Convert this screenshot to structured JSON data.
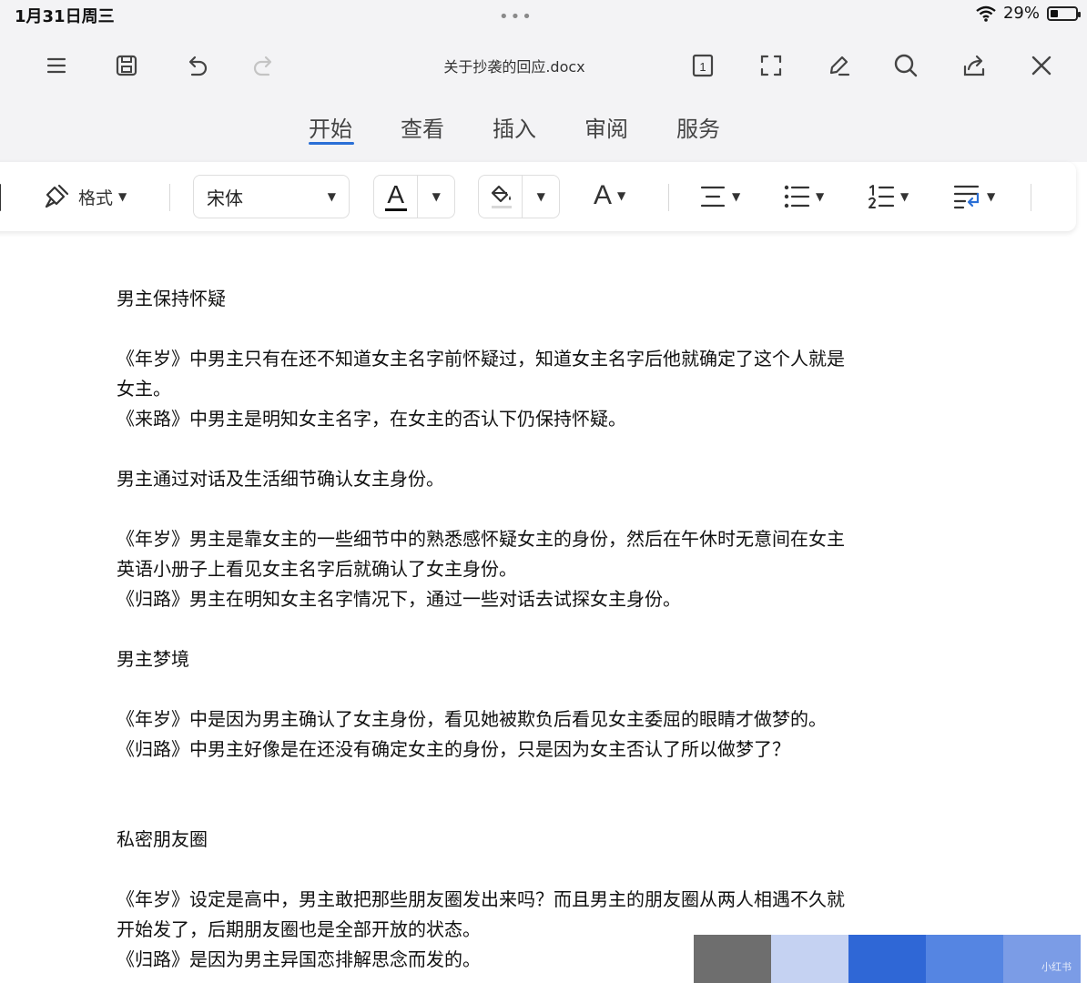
{
  "status": {
    "time": "1月31日周三",
    "dots": "•••",
    "battery": "29%",
    "battery_level": 0.29
  },
  "toolbar": {
    "title": "关于抄袭的回应.docx",
    "page_badge": "1"
  },
  "tabs": [
    {
      "label": "开始",
      "active": true
    },
    {
      "label": "查看",
      "active": false
    },
    {
      "label": "插入",
      "active": false
    },
    {
      "label": "审阅",
      "active": false
    },
    {
      "label": "服务",
      "active": false
    }
  ],
  "ribbon": {
    "format_label": "格式",
    "font_name": "宋体",
    "font_color_glyph": "A",
    "font_size_glyph": "A"
  },
  "document": {
    "s1_heading": "男主保持怀疑",
    "s1_p1_l1": "《年岁》中男主只有在还不知道女主名字前怀疑过，知道女主名字后他就确定了这个人就是",
    "s1_p1_l2": "女主。",
    "s1_p2": "《来路》中男主是明知女主名字，在女主的否认下仍保持怀疑。",
    "s2_heading": "男主通过对话及生活细节确认女主身份。",
    "s2_p1_l1": "《年岁》男主是靠女主的一些细节中的熟悉感怀疑女主的身份，然后在午休时无意间在女主",
    "s2_p1_l2": "英语小册子上看见女主名字后就确认了女主身份。",
    "s2_p2": "《归路》男主在明知女主名字情况下，通过一些对话去试探女主身份。",
    "s3_heading": "男主梦境",
    "s3_p1": "《年岁》中是因为男主确认了女主身份，看见她被欺负后看见女主委屈的眼睛才做梦的。",
    "s3_p2": "《归路》中男主好像是在还没有确定女主的身份，只是因为女主否认了所以做梦了？",
    "s4_heading": "私密朋友圈",
    "s4_p1_l1": "《年岁》设定是高中，男主敢把那些朋友圈发出来吗？而且男主的朋友圈从两人相遇不久就",
    "s4_p1_l2": "开始发了，后期朋友圈也是全部开放的状态。",
    "s4_p2": "《归路》是因为男主异国恋排解思念而发的。"
  },
  "swatches": [
    "#6e6e6e",
    "#c5d2f2",
    "#2f67d6",
    "#5585e2",
    "#7b9ce6"
  ],
  "watermark": "小红书",
  "colors": {
    "accent": "#2a6fd6",
    "chrome": "#f3f3f5"
  }
}
